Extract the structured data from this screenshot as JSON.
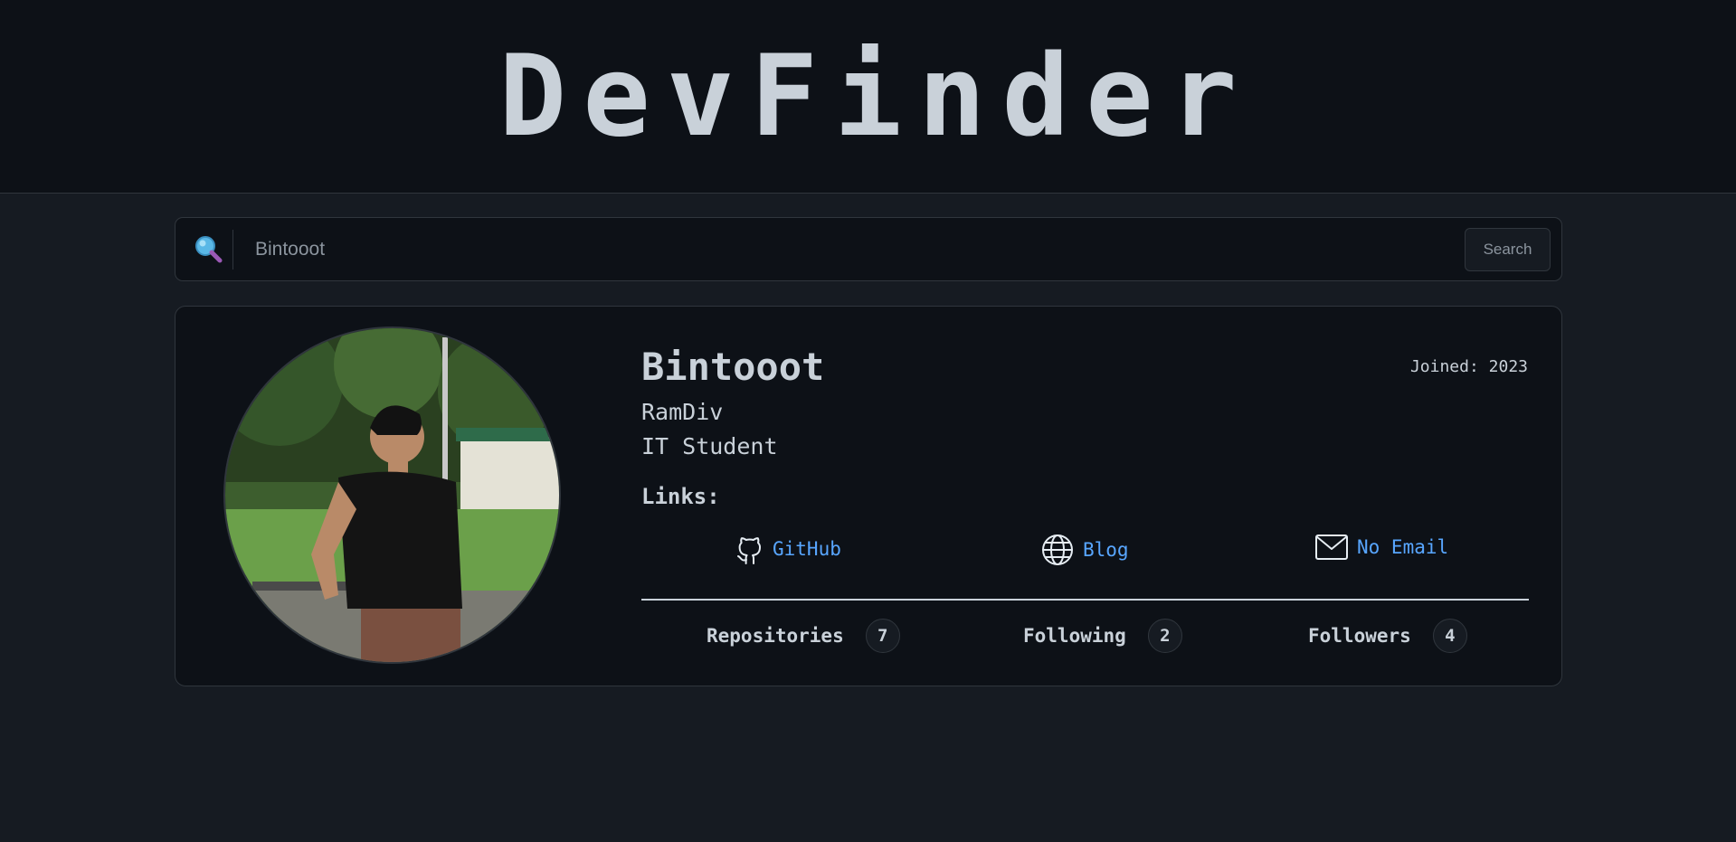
{
  "app": {
    "title": "DevFinder"
  },
  "search": {
    "value": "Bintooot",
    "button_label": "Search",
    "icon": "magnifying-glass-icon"
  },
  "profile": {
    "name": "Bintooot",
    "joined": "Joined: 2023",
    "login": "RamDiv",
    "bio": "IT Student",
    "links_heading": "Links:",
    "links": [
      {
        "icon": "github-icon",
        "label": "GitHub"
      },
      {
        "icon": "globe-icon",
        "label": "Blog"
      },
      {
        "icon": "mail-icon",
        "label": "No Email"
      }
    ],
    "stats": [
      {
        "label": "Repositories",
        "count": "7"
      },
      {
        "label": "Following",
        "count": "2"
      },
      {
        "label": "Followers",
        "count": "4"
      }
    ]
  },
  "colors": {
    "header_bg": "#0d1117",
    "page_bg": "#161b22",
    "text": "#c9d1d9",
    "link": "#58a6ff",
    "border": "#30363d"
  }
}
